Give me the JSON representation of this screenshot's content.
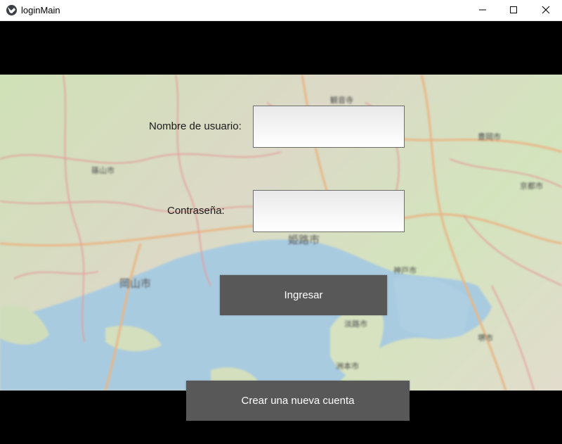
{
  "window": {
    "title": "loginMain",
    "app_icon": "kivy-logo-icon",
    "controls": [
      "minimize-icon",
      "maximize-icon",
      "close-icon"
    ]
  },
  "background": {
    "kind": "blurred street map",
    "map_labels": [
      "観音寺",
      "篠山市",
      "神戸市",
      "京都市",
      "岡山市",
      "姫路市",
      "堺市",
      "豊岡市",
      "淡路市",
      "洲本市"
    ]
  },
  "form": {
    "username_label": "Nombre de usuario:",
    "username_value": "",
    "password_label": "Contraseña:",
    "password_value": ""
  },
  "buttons": {
    "login": "Ingresar",
    "create_account": "Crear una nueva cuenta"
  },
  "colors": {
    "button_bg": "#585858",
    "button_text": "#ffffff",
    "frame_bg": "#000000"
  }
}
